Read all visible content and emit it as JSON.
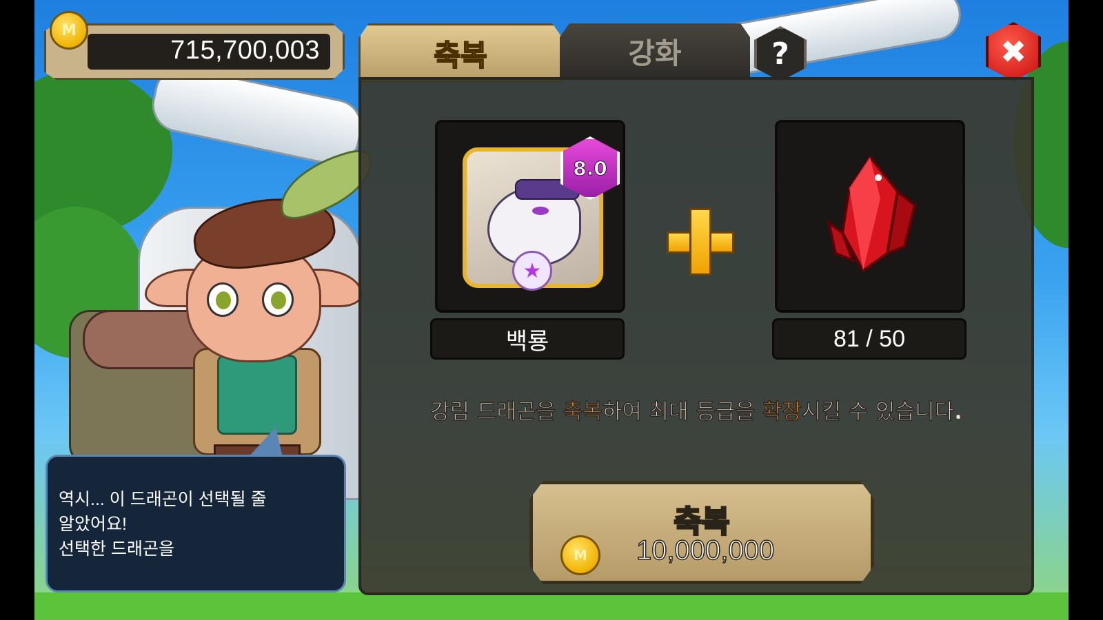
{
  "currency": {
    "icon": "m-coin-icon",
    "coin_letter": "M",
    "amount": "715,700,003"
  },
  "tabs": [
    {
      "label": "축복",
      "active": true
    },
    {
      "label": "강화",
      "active": false
    }
  ],
  "help": {
    "glyph": "?"
  },
  "close": {
    "glyph": "✖"
  },
  "dialog": {
    "lines": [
      "역시... 이 드래곤이 선택될 줄",
      "알았어요!",
      "선택한 드래곤을"
    ]
  },
  "dragon_slot": {
    "name": "백룡",
    "grade": "8.0",
    "star_glyph": "★"
  },
  "material_slot": {
    "icon": "red-crystal-icon",
    "count": "81 / 50"
  },
  "plus_icon": "plus-icon",
  "description": {
    "p1": "강림 드래곤을 ",
    "h1": "축복",
    "p2": "하여 최대 등급을 ",
    "h2": "확장",
    "p3": "시킬 수 있습니다."
  },
  "bless_button": {
    "label": "축복",
    "coin_letter": "M",
    "cost": "10,000,000"
  },
  "colors": {
    "accent_gold": "#ffd21a",
    "highlight_orange": "#ff9c2a",
    "close_red": "#c80f0f",
    "grade_magenta": "#e64ad8"
  }
}
